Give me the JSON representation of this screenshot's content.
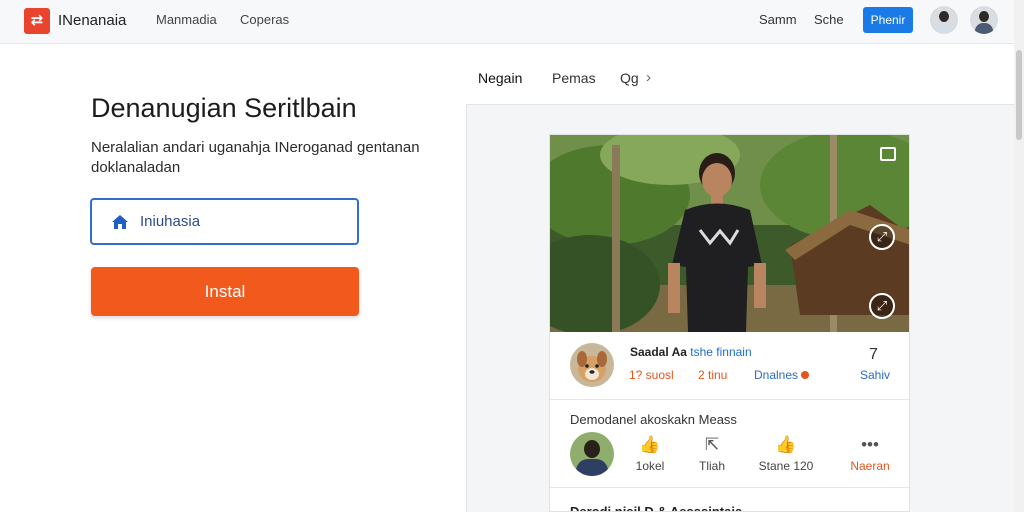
{
  "topbar": {
    "brand": "INenanaia",
    "nav": [
      "Manmadia",
      "Coperas"
    ],
    "links": [
      "Samm",
      "Sche"
    ],
    "button_label": "Phenir",
    "logo_icon": "brand-logo-icon"
  },
  "hero": {
    "title": "Denanugian Seritlbain",
    "description": "Neralalian andari uganahja INeroganad gentanan doklanaladan",
    "field_value": "Iniuhasia",
    "field_icon": "home-icon",
    "install_label": "Instal"
  },
  "panel": {
    "tabs": [
      "Negain",
      "Pemas",
      "Qg"
    ],
    "accent_color": "#1a7ae6",
    "install_color": "#f15a1c"
  },
  "card": {
    "row1": {
      "name_bold": "Saadal Aa",
      "name_blue": "tshe finnain",
      "stat1": "1? suosl",
      "stat2": "2 tinu",
      "stat3": "Dnalnes",
      "count": "7",
      "save": "Sahiv"
    },
    "row2": {
      "title": "Demodanel akoskakn Meass",
      "actions": [
        {
          "icon": "like-icon",
          "label": "1okel"
        },
        {
          "icon": "share-icon",
          "label": "Tliah"
        },
        {
          "icon": "thumb-icon",
          "label": "Stane 120"
        },
        {
          "icon": "more-icon",
          "label": "Naeran"
        }
      ]
    },
    "row3": {
      "text": "Derodi   nisil  D & Aesssintaia"
    }
  }
}
